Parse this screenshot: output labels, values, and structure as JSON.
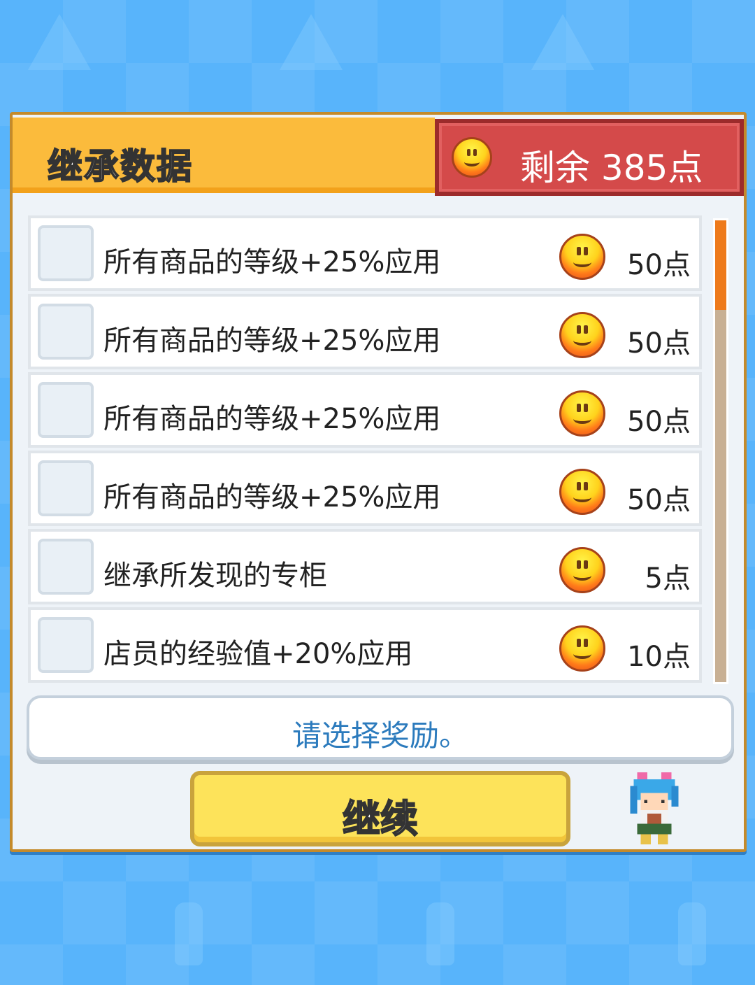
{
  "header": {
    "title": "继承数据",
    "remaining_label": "剩余 385点"
  },
  "rewards": [
    {
      "label": "所有商品的等级+25%应用",
      "cost": "50点",
      "checked": false
    },
    {
      "label": "所有商品的等级+25%应用",
      "cost": "50点",
      "checked": false
    },
    {
      "label": "所有商品的等级+25%应用",
      "cost": "50点",
      "checked": false
    },
    {
      "label": "所有商品的等级+25%应用",
      "cost": "50点",
      "checked": false
    },
    {
      "label": "继承所发现的专柜",
      "cost": "5点",
      "checked": false
    },
    {
      "label": "店员的经验值+20%应用",
      "cost": "10点",
      "checked": false
    }
  ],
  "message": "请选择奖励。",
  "continue_label": "继续",
  "colors": {
    "background": "#58b4fb",
    "title_bar": "#fbbb3c",
    "remaining_bg": "#d44a4a",
    "message_text": "#2c7bbd",
    "continue_bg": "#fde35a",
    "scroll_thumb": "#ee7a1b"
  },
  "icons": {
    "coin": "smiley-coin-icon",
    "character": "shop-clerk-character"
  }
}
